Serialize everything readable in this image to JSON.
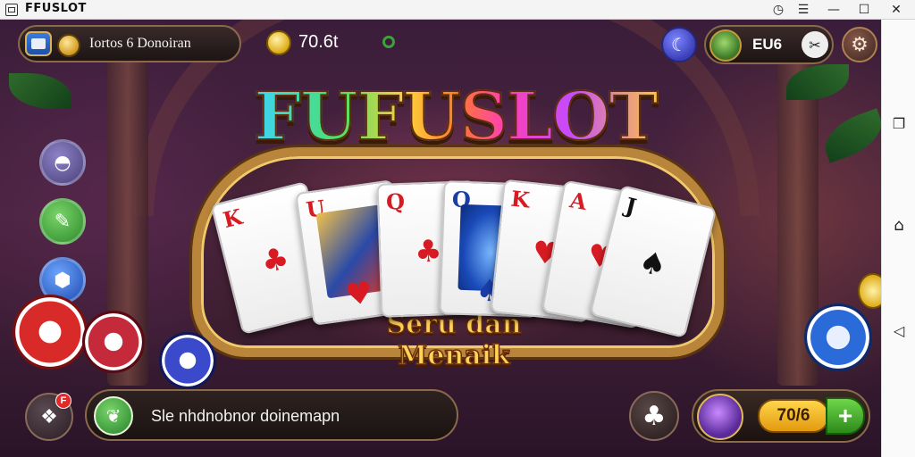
{
  "window": {
    "title": "FFUSLOT",
    "icons": [
      "app-icon",
      "timer-icon",
      "wifi-icon",
      "minimize-icon",
      "maximize-icon",
      "close-icon"
    ]
  },
  "hud": {
    "profile_label": "Iortos 6 Donoiran",
    "gold_value": "70.6t",
    "username": "EU6"
  },
  "logo": {
    "title": "FUFUSLOT",
    "tagline": "Seru dan Menaik"
  },
  "cards": [
    {
      "rank": "K",
      "suit": "♣",
      "color": "red"
    },
    {
      "rank": "U",
      "suit": "♥",
      "color": "red"
    },
    {
      "rank": "Q",
      "suit": "♣",
      "color": "red"
    },
    {
      "rank": "Q",
      "suit": "♠",
      "color": "blue"
    },
    {
      "rank": "K",
      "suit": "♥",
      "color": "red"
    },
    {
      "rank": "A",
      "suit": "♥",
      "color": "red"
    },
    {
      "rank": "J",
      "suit": "♠",
      "color": "black"
    }
  ],
  "bottom": {
    "notification_badge": "F",
    "chat_text": "Sle nhdnobnor doinemapn",
    "shop_amount": "70/6",
    "plus_label": "+"
  },
  "colors": {
    "gold": "#ffd35a",
    "accent_green": "#3ba33b",
    "badge_red": "#e02a2a"
  }
}
